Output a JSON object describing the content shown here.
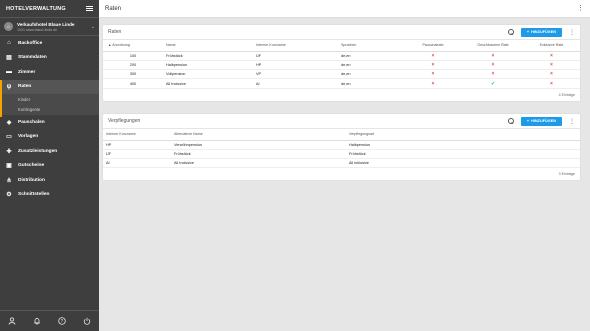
{
  "app": {
    "title": "HOTELVERWALTUNG"
  },
  "hotel": {
    "name": "Verkaufshotel Blaue Linde",
    "sub": "1031 www.blaue-linde.de"
  },
  "sidebar": {
    "items": [
      {
        "label": "Backoffice",
        "icon": "home-icon"
      },
      {
        "label": "Stammdaten",
        "icon": "database-icon"
      },
      {
        "label": "Zimmer",
        "icon": "bed-icon"
      },
      {
        "label": "Raten",
        "icon": "cutlery-icon"
      },
      {
        "label": "Pauschalen",
        "icon": "tag-icon"
      },
      {
        "label": "Vorlagen",
        "icon": "folder-icon"
      },
      {
        "label": "Zusatzleistungen",
        "icon": "plus-icon"
      },
      {
        "label": "Gutscheine",
        "icon": "gift-icon"
      },
      {
        "label": "Distribution",
        "icon": "network-icon"
      },
      {
        "label": "Schnittstellen",
        "icon": "plug-icon"
      }
    ],
    "subitems": [
      {
        "label": "Kinder"
      },
      {
        "label": "Kontingente"
      }
    ],
    "footer": [
      "user-icon",
      "bell-icon",
      "help-icon",
      "power-icon"
    ]
  },
  "topbar": {
    "title": "Raten"
  },
  "raten": {
    "title": "Raten",
    "add_label": "HINZUFÜGEN",
    "columns": [
      "Anordnung",
      "Name",
      "Interner Kurzname",
      "Sprachen",
      "Pauschalrate",
      "Geschlossene Rate",
      "Exklusive Rate"
    ],
    "rows": [
      {
        "order": "100",
        "name": "Frühstück",
        "short": "ÜF",
        "lang": "de,en",
        "pauschal": "×",
        "geschlossen": "×",
        "exklusiv": "×"
      },
      {
        "order": "200",
        "name": "Halbpension",
        "short": "HP",
        "lang": "de,en",
        "pauschal": "×",
        "geschlossen": "×",
        "exklusiv": "×"
      },
      {
        "order": "300",
        "name": "Vollpension",
        "short": "VP",
        "lang": "de,en",
        "pauschal": "×",
        "geschlossen": "×",
        "exklusiv": "×"
      },
      {
        "order": "400",
        "name": "All Inclusive",
        "short": "AI",
        "lang": "de,en",
        "pauschal": "×",
        "geschlossen": "✓",
        "exklusiv": "×"
      }
    ],
    "footer": "4 Einträge"
  },
  "verpflegungen": {
    "title": "Verpflegungen",
    "add_label": "HINZUFÜGEN",
    "columns": [
      "Interner Kurzname",
      "Alternativer Name",
      "Verpflegungsart"
    ],
    "rows": [
      {
        "short": "HP",
        "alt": "Verwöhnpension",
        "type": "Halbpension"
      },
      {
        "short": "ÜF",
        "alt": "Frühstück",
        "type": "Frühstück"
      },
      {
        "short": "AI",
        "alt": "All Inclusive",
        "type": "All inklusive"
      }
    ],
    "footer": "3 Einträge"
  },
  "colors": {
    "accent": "#1e9be8",
    "sidebar": "#3e3e3e",
    "active_bar": "#f2a500",
    "cross": "#e34b4b",
    "check": "#35a853"
  }
}
